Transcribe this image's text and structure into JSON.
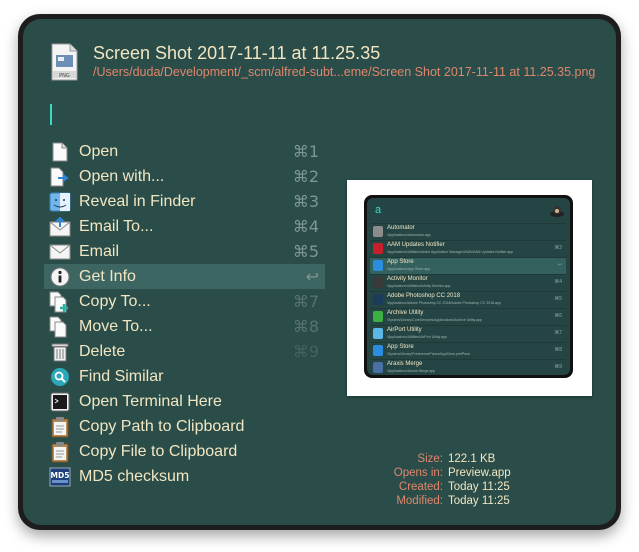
{
  "header": {
    "title": "Screen Shot 2017-11-11 at 11.25.35",
    "subtitle": "/Users/duda/Development/_scm/alfred-subt...eme/Screen Shot 2017-11-11 at 11.25.35.png",
    "file_icon": "png-file-icon",
    "file_icon_text": "PNG"
  },
  "query": "",
  "actions": [
    {
      "label": "Open",
      "shortcut": "⌘1",
      "icon": "document-icon"
    },
    {
      "label": "Open with...",
      "shortcut": "⌘2",
      "icon": "open-with-icon"
    },
    {
      "label": "Reveal in Finder",
      "shortcut": "⌘3",
      "icon": "finder-icon"
    },
    {
      "label": "Email To...",
      "shortcut": "⌘4",
      "icon": "email-to-icon"
    },
    {
      "label": "Email",
      "shortcut": "⌘5",
      "icon": "envelope-icon"
    },
    {
      "label": "Get Info",
      "shortcut": "↩",
      "icon": "info-icon"
    },
    {
      "label": "Copy To...",
      "shortcut": "⌘7",
      "icon": "copy-to-icon"
    },
    {
      "label": "Move To...",
      "shortcut": "⌘8",
      "icon": "move-to-icon"
    },
    {
      "label": "Delete",
      "shortcut": "⌘9",
      "icon": "trash-icon"
    },
    {
      "label": "Find Similar",
      "shortcut": "",
      "icon": "magnifier-icon"
    },
    {
      "label": "Open Terminal Here",
      "shortcut": "",
      "icon": "terminal-icon"
    },
    {
      "label": "Copy Path to Clipboard",
      "shortcut": "",
      "icon": "clipboard-icon"
    },
    {
      "label": "Copy File to Clipboard",
      "shortcut": "",
      "icon": "clipboard-icon"
    },
    {
      "label": "MD5 checksum",
      "shortcut": "",
      "icon": "md5-icon"
    }
  ],
  "preview": {
    "query": "a",
    "items": [
      {
        "title": "Automator",
        "sub": "/Applications/Automator.app",
        "sc": "",
        "color": "#8c8c8c"
      },
      {
        "title": "AAM Updates Notifier",
        "sub": "/Applications/Utilities/Adobe Application Manager/UWA/AAM Updates Notifier.app",
        "sc": "⌘2",
        "color": "#c8202b"
      },
      {
        "title": "App Store",
        "sub": "/Applications/App Store.app",
        "sc": "↩",
        "color": "#2a8de0"
      },
      {
        "title": "Activity Monitor",
        "sub": "/Applications/Utilities/Activity Monitor.app",
        "sc": "⌘4",
        "color": "#3a3a3a"
      },
      {
        "title": "Adobe Photoshop CC 2018",
        "sub": "/Applications/Adobe Photoshop CC 2018/Adobe Photoshop CC 2018.app",
        "sc": "⌘5",
        "color": "#1b3a5c"
      },
      {
        "title": "Archive Utility",
        "sub": "/System/Library/CoreServices/Applications/Archive Utility.app",
        "sc": "⌘6",
        "color": "#3cb043"
      },
      {
        "title": "AirPort Utility",
        "sub": "/Applications/Utilities/AirPort Utility.app",
        "sc": "⌘7",
        "color": "#5ab7e8"
      },
      {
        "title": "App Store",
        "sub": "/System/Library/PreferencePanes/AppStore.prefPane",
        "sc": "⌘8",
        "color": "#2a8de0"
      },
      {
        "title": "Araxis Merge",
        "sub": "/Applications/Araxis Merge.app",
        "sc": "⌘9",
        "color": "#4a6fa5"
      }
    ]
  },
  "meta": {
    "size_label": "Size:",
    "size": "122.1 KB",
    "opens_label": "Opens in:",
    "opens": "Preview.app",
    "created_label": "Created:",
    "created": "Today 11:25",
    "modified_label": "Modified:",
    "modified": "Today 11:25"
  },
  "colors": {
    "background": "#2a4d4a",
    "title": "#f2e6c2",
    "subtitle": "#e0866b",
    "cursor": "#3fd6c6",
    "selection": "#3d6663"
  }
}
